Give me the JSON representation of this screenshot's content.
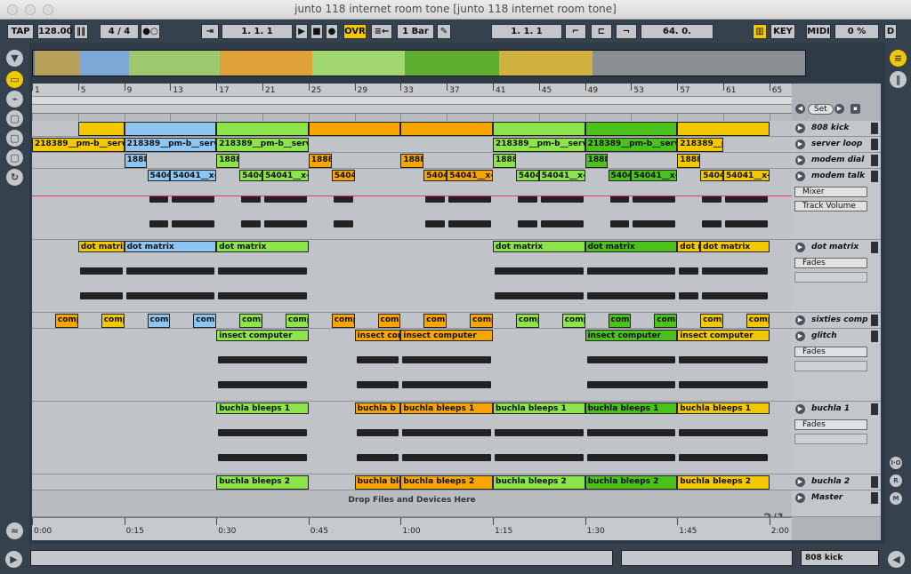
{
  "window": {
    "title": "junto 118 internet room tone  [junto 118 internet room tone]"
  },
  "control_bar": {
    "tap": "TAP",
    "tempo": "128.00",
    "signature": "4 / 4",
    "arrangement_position": "1.   1.   1",
    "ovr": "OVR",
    "quantize": "1 Bar",
    "loop_start": "1.   1.   1",
    "loop_length": "64.   0.",
    "key": "KEY",
    "midi": "MIDI",
    "cpu": "0 %",
    "d": "D"
  },
  "ruler": {
    "bars": [
      "1",
      "5",
      "9",
      "13",
      "17",
      "21",
      "25",
      "29",
      "33",
      "37",
      "41",
      "45",
      "49",
      "53",
      "57",
      "61",
      "65"
    ]
  },
  "arrangement": {
    "set_label": "Set",
    "drop_text": "Drop Files and Devices Here",
    "counter": "2/1"
  },
  "clips": {
    "server": [
      "218389__pm-b__server",
      "218389__pm-b__server",
      "218389__pm-b__server",
      "218389__pm-b__server",
      "218389__pm-b__server",
      "218389__pm"
    ],
    "modem": [
      "18882",
      "18882",
      "18882",
      "18882",
      "18882",
      "18882",
      "18882"
    ],
    "talk": [
      "5404",
      "54041__x-3",
      "5404",
      "54041__x-3",
      "5404",
      "5404",
      "54041__x-3",
      "5404",
      "54041__x-3",
      "5404",
      "54041__x-3",
      "5404",
      "54041__x-3"
    ],
    "dot": [
      "dot matrix",
      "dot matrix",
      "dot matrix",
      "dot matrix",
      "dot matrix",
      "dot m",
      "dot matrix"
    ],
    "comp": "comp",
    "insect": [
      "insect computer",
      "insect com",
      "insect computer",
      "insect computer",
      "insect computer"
    ],
    "bb1": [
      "buchla bleeps 1",
      "buchla b",
      "buchla bleeps 1",
      "buchla bleeps 1",
      "buchla bleeps 1",
      "buchla bleeps 1"
    ],
    "bb2": [
      "buchla bleeps 2",
      "buchla blee",
      "buchla bleeps 2",
      "buchla bleeps 2",
      "buchla bleeps 2",
      "buchla bleeps 2"
    ]
  },
  "tracks": [
    {
      "name": "808 kick"
    },
    {
      "name": "server loop"
    },
    {
      "name": "modem dial"
    },
    {
      "name": "modem talk"
    },
    {
      "name": "dot matrix"
    },
    {
      "name": "sixties comp"
    },
    {
      "name": "glitch"
    },
    {
      "name": "buchla 1"
    },
    {
      "name": "buchla 2"
    },
    {
      "name": "Master"
    }
  ],
  "device": {
    "mixer": "Mixer",
    "volume": "Track Volume",
    "fades": "Fades"
  },
  "timeline": {
    "times": [
      "0:00",
      "0:15",
      "0:30",
      "0:45",
      "1:00",
      "1:15",
      "1:30",
      "1:45",
      "2:00"
    ]
  },
  "status": {
    "track": "808 kick"
  },
  "colors": {
    "yellow": "#f2c800",
    "blue": "#8ec5f3",
    "green": "#8ce44a",
    "orange": "#f7a600",
    "dkgreen": "#4bc21c",
    "magenta": "#e8346f"
  }
}
